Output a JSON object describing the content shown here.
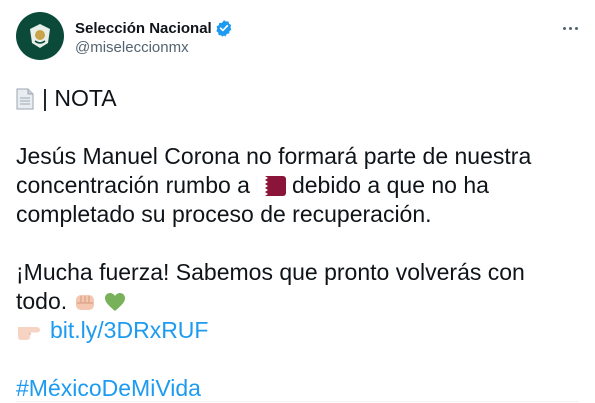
{
  "author": {
    "display_name": "Selección Nacional",
    "handle": "@miseleccionmx",
    "verified": true,
    "avatar_color": "#0b4a39"
  },
  "tweet": {
    "header": "| NOTA",
    "line1": "Jesús Manuel Corona no formará parte de nuestra",
    "line2_a": "concentración rumbo a",
    "line2_b": "debido a que no ha",
    "line3": "completado su proceso de recuperación.",
    "line4": "¡Mucha fuerza! Sabemos que pronto volverás con",
    "line5": "todo.",
    "link": "bit.ly/3DRxRUF",
    "hashtag": "#MéxicoDeMiVida",
    "emojis": [
      "page-facing-up",
      "qatar-flag",
      "fist",
      "green-heart",
      "pointing-right"
    ]
  },
  "colors": {
    "link": "#1d9bf0",
    "text": "#0f1419",
    "secondary": "#536471",
    "verified": "#1d9bf0"
  }
}
